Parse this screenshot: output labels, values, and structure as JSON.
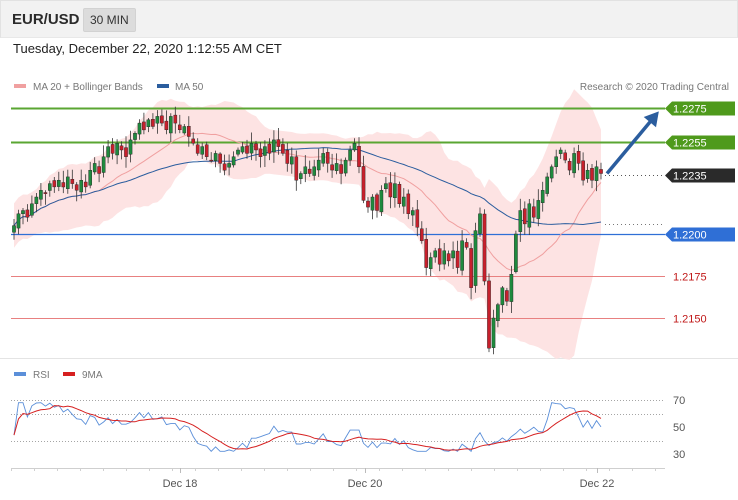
{
  "header": {
    "symbol": "EUR/USD",
    "timeframe": "30 MIN"
  },
  "datetime": "Tuesday, December 22, 2020 1:12:55 AM CET",
  "credit": "Research © 2020 Trading Central",
  "colors": {
    "up": "#1f8a3e",
    "down": "#c7202c",
    "band_fill": "#fde1e1",
    "ma20": "#f0a0a0",
    "ma50": "#2b5d9e",
    "resistance": "#5aa632",
    "support": "#2f6fd6",
    "minor_support": "#e88080",
    "rsi": "#5b8fd9",
    "rsi_ma": "#d62020",
    "arrow": "#2b5d9e"
  },
  "chart_data": [
    {
      "type": "candlestick",
      "title": "",
      "legend": [
        "MA 20 + Bollinger Bands",
        "MA 50"
      ],
      "legend_position": "top-left",
      "ylim": [
        1.2125,
        1.229
      ],
      "x_ticks": [
        "Dec 18",
        "Dec 20",
        "Dec 22"
      ],
      "levels": [
        {
          "label": "1.2275",
          "value": 1.2275,
          "kind": "resistance"
        },
        {
          "label": "1.2255",
          "value": 1.2255,
          "kind": "resistance"
        },
        {
          "label": "1.2235",
          "value": 1.2235,
          "kind": "last"
        },
        {
          "label": "1.2200",
          "value": 1.22,
          "kind": "support"
        },
        {
          "label": "1.2175",
          "value": 1.2175,
          "kind": "minor"
        },
        {
          "label": "1.2150",
          "value": 1.215,
          "kind": "minor"
        }
      ],
      "close": [
        1.2205,
        1.2212,
        1.2214,
        1.221,
        1.2218,
        1.2222,
        1.2226,
        1.2224,
        1.223,
        1.2228,
        1.2232,
        1.2228,
        1.2234,
        1.223,
        1.2226,
        1.2232,
        1.2228,
        1.2238,
        1.2242,
        1.2236,
        1.2246,
        1.2252,
        1.2248,
        1.2254,
        1.225,
        1.2246,
        1.2256,
        1.226,
        1.2266,
        1.2262,
        1.2268,
        1.2264,
        1.227,
        1.2266,
        1.2262,
        1.227,
        1.2266,
        1.2262,
        1.2264,
        1.2258,
        1.2254,
        1.2248,
        1.2252,
        1.2246,
        1.2244,
        1.2248,
        1.2242,
        1.2238,
        1.2242,
        1.2246,
        1.225,
        1.2252,
        1.2248,
        1.2254,
        1.225,
        1.2246,
        1.2252,
        1.2248,
        1.2256,
        1.2252,
        1.2248,
        1.2242,
        1.2246,
        1.2232,
        1.2236,
        1.224,
        1.2236,
        1.224,
        1.2244,
        1.2248,
        1.2242,
        1.2238,
        1.2242,
        1.2236,
        1.2244,
        1.225,
        1.2254,
        1.224,
        1.222,
        1.2216,
        1.2222,
        1.2214,
        1.2226,
        1.223,
        1.2222,
        1.223,
        1.2218,
        1.2222,
        1.2212,
        1.2214,
        1.2204,
        1.2196,
        1.218,
        1.2186,
        1.219,
        1.2182,
        1.219,
        1.2184,
        1.219,
        1.218,
        1.2196,
        1.2192,
        1.2168,
        1.2202,
        1.2212,
        1.2172,
        1.2132,
        1.215,
        1.2158,
        1.2168,
        1.216,
        1.2176,
        1.22,
        1.2214,
        1.2206,
        1.2218,
        1.221,
        1.222,
        1.2226,
        1.2234,
        1.224,
        1.2246,
        1.225,
        1.2244,
        1.2238,
        1.2248,
        1.2242,
        1.2232,
        1.2238,
        1.2232,
        1.224,
        1.2236
      ],
      "rsi": {
        "legend": [
          "RSI",
          "9MA"
        ],
        "ylim": [
          20,
          80
        ],
        "ticks": [
          "70",
          "50",
          "30"
        ],
        "levels": [
          70,
          60,
          40
        ]
      }
    }
  ]
}
